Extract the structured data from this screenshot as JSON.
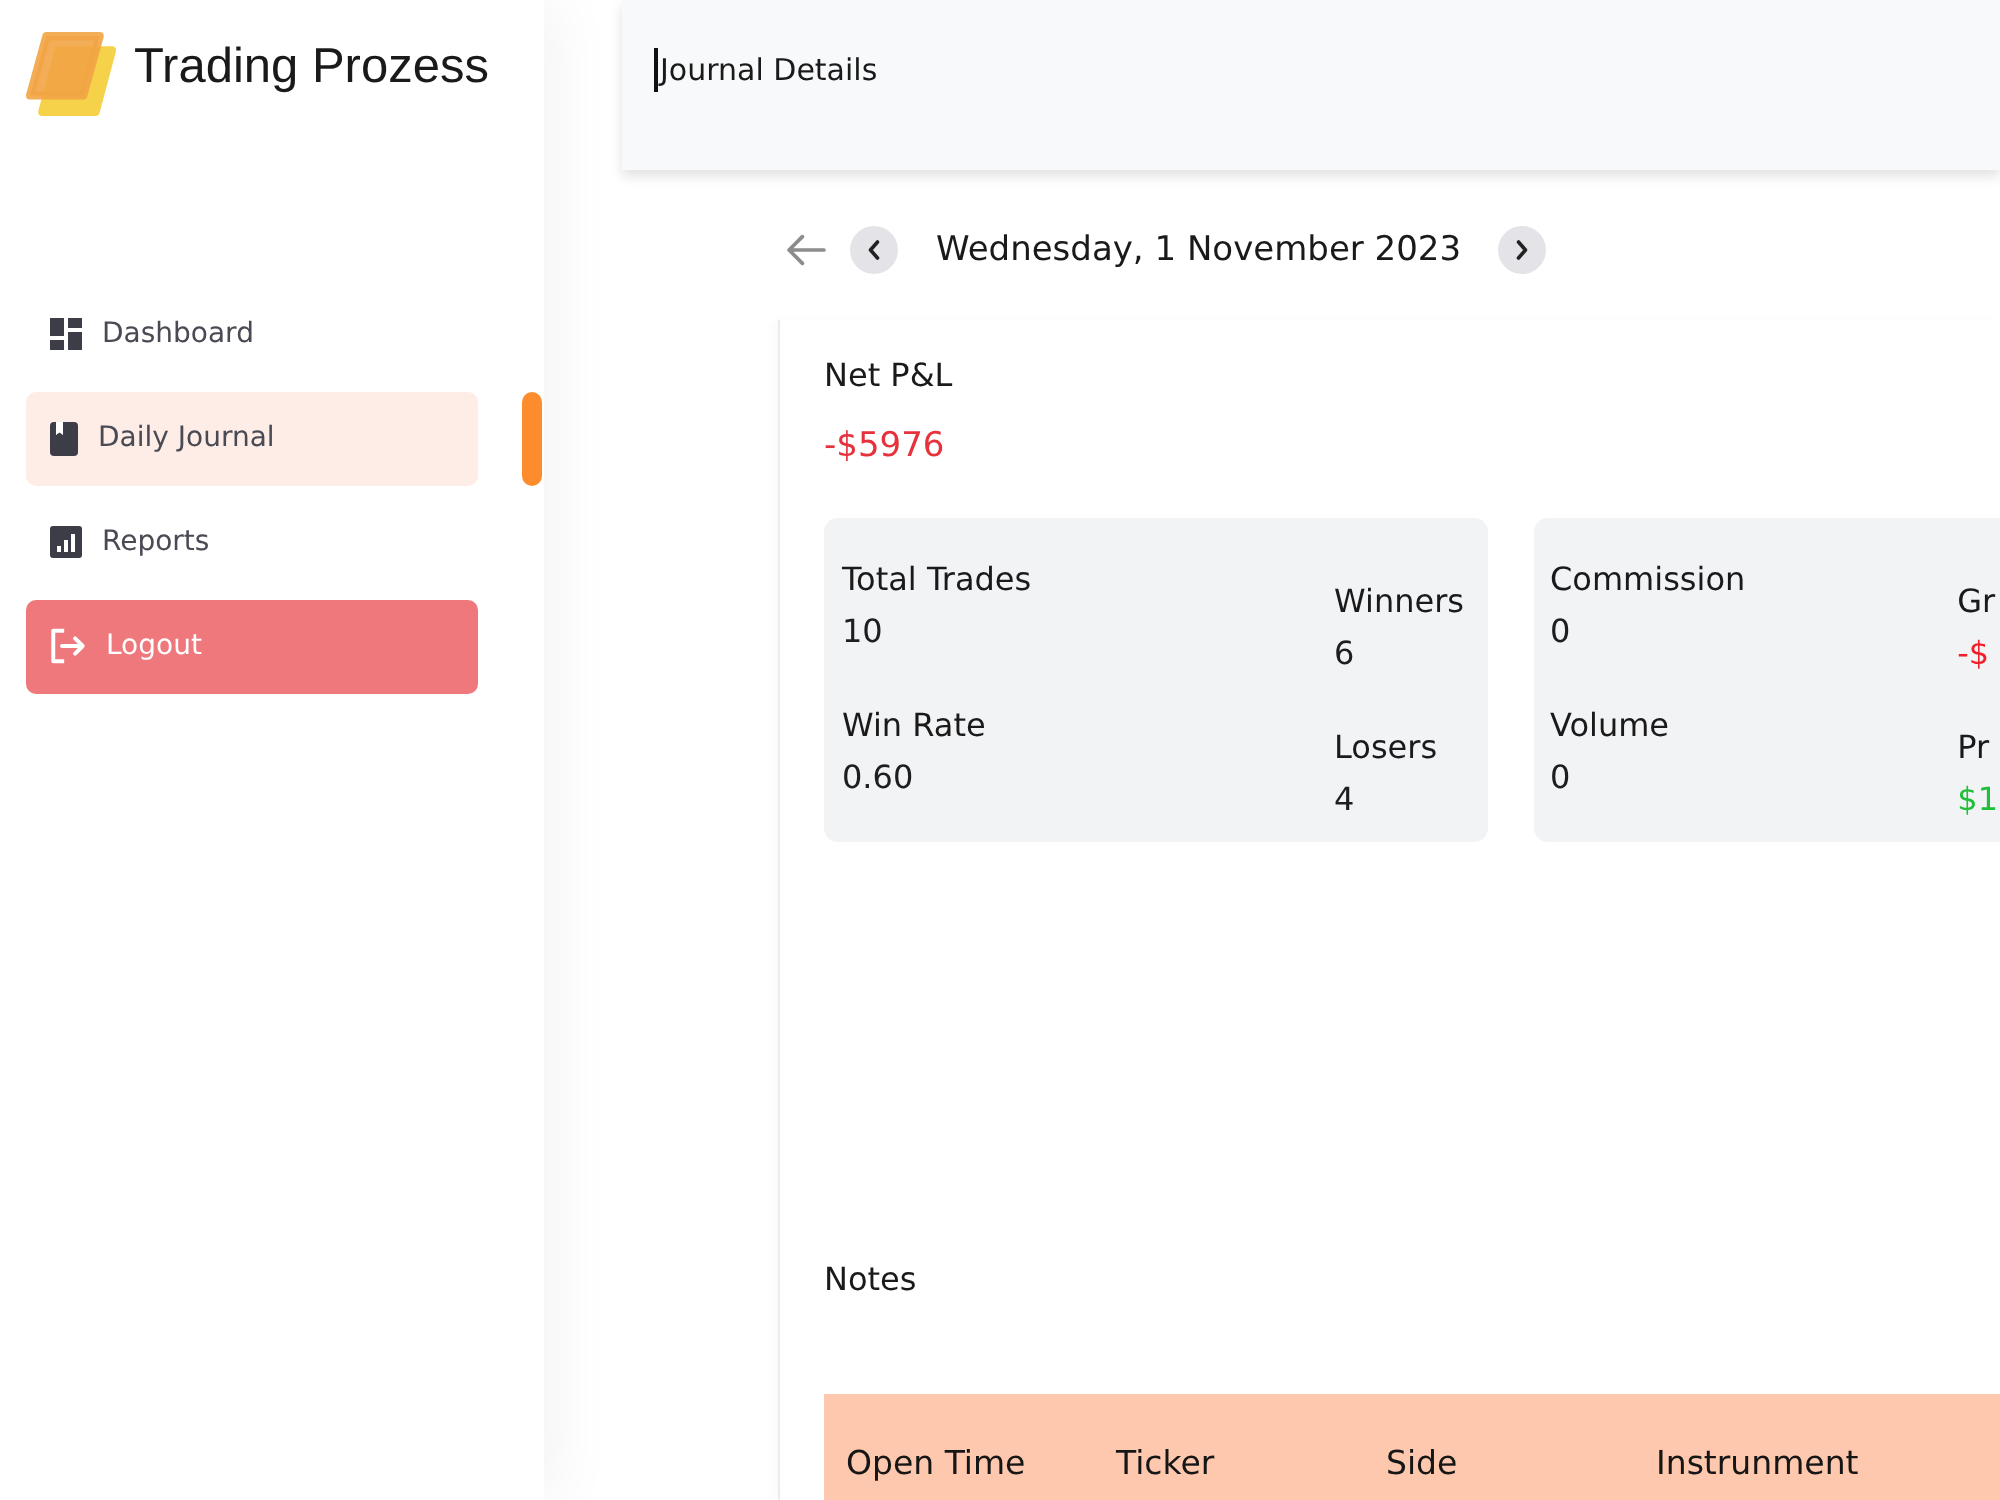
{
  "logo": {
    "text": "Trading Prozess"
  },
  "sidebar": {
    "items": [
      {
        "label": "Dashboard",
        "kind": "link",
        "selected": false
      },
      {
        "label": "Daily Journal",
        "kind": "link",
        "selected": true
      },
      {
        "label": "Reports",
        "kind": "link",
        "selected": false
      },
      {
        "label": "Logout",
        "kind": "logout",
        "selected": false
      }
    ]
  },
  "header": {
    "title": "Journal Details"
  },
  "date_nav": {
    "date": "Wednesday, 1 November 2023"
  },
  "net_pnl": {
    "label": "Net P&L",
    "value": "-$5976",
    "color": "#e5323c"
  },
  "stat_cards": [
    {
      "columns": [
        [
          {
            "label": "Total Trades",
            "value": "10",
            "color": "#1e1e1e"
          },
          {
            "label": "Win Rate",
            "value": "0.60",
            "color": "#1e1e1e"
          }
        ],
        [
          {
            "label": "Winners",
            "value": "6",
            "color": "#1e1e1e"
          },
          {
            "label": "Losers",
            "value": "4",
            "color": "#1e1e1e"
          }
        ]
      ]
    },
    {
      "columns": [
        [
          {
            "label": "Commission",
            "value": "0",
            "color": "#1e1e1e"
          },
          {
            "label": "Volume",
            "value": "0",
            "color": "#1e1e1e"
          }
        ],
        [
          {
            "label": "Gr",
            "value": "-$",
            "color": "#f0202a"
          },
          {
            "label": "Pr",
            "value": "$1",
            "color": "#1fbf3a"
          }
        ]
      ]
    }
  ],
  "notes": {
    "label": "Notes"
  },
  "table": {
    "columns": [
      "Open Time",
      "Ticker",
      "Side",
      "Instrunment"
    ]
  }
}
